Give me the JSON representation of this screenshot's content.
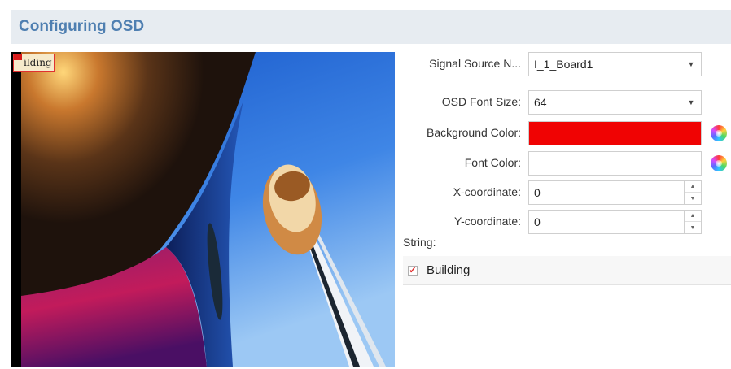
{
  "header": {
    "title": "Configuring OSD"
  },
  "preview": {
    "osd_text": "ilding"
  },
  "form": {
    "signal_source": {
      "label": "Signal Source N...",
      "value": "I_1_Board1"
    },
    "font_size": {
      "label": "OSD Font Size:",
      "value": "64"
    },
    "background_color": {
      "label": "Background Color:",
      "color": "#f00303"
    },
    "font_color": {
      "label": "Font Color:",
      "color": "#ffffff"
    },
    "x_coordinate": {
      "label": "X-coordinate:",
      "value": "0"
    },
    "y_coordinate": {
      "label": "Y-coordinate:",
      "value": "0"
    }
  },
  "strings": {
    "label": "String:",
    "items": [
      {
        "text": "Building",
        "checked": true
      }
    ]
  }
}
